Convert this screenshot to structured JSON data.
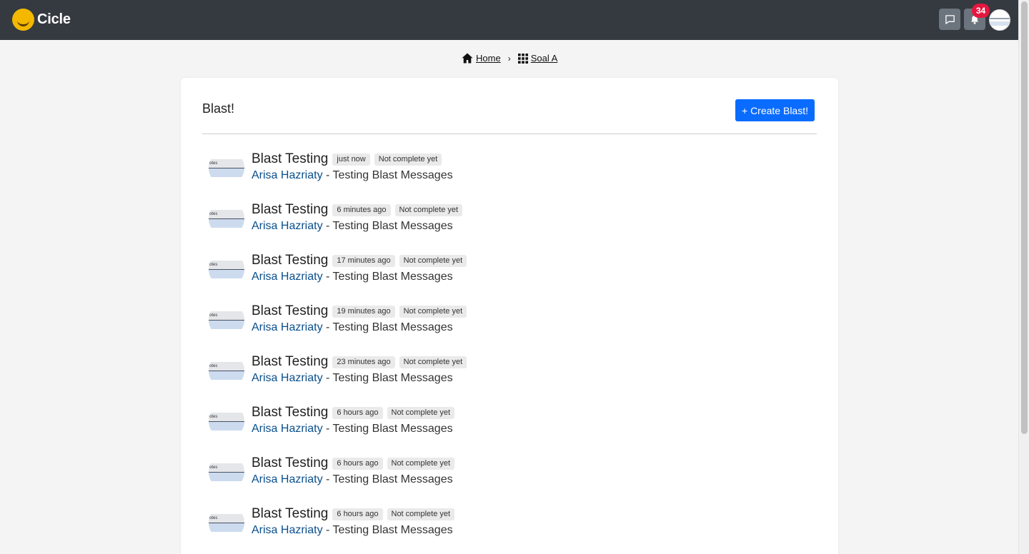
{
  "app": {
    "name": "Cicle",
    "notification_count": "34"
  },
  "breadcrumb": {
    "home_label": "Home",
    "current_label": "Soal A"
  },
  "page": {
    "title": "Blast!",
    "create_button_label": "+ Create Blast!"
  },
  "colors": {
    "topbar": "#343a40",
    "accent": "#0a6cff",
    "badge": "#e5173f",
    "author_link": "#0a4f8c"
  },
  "icons": {
    "chat": "chat-icon",
    "bell": "bell-icon",
    "home": "home-icon",
    "grid": "grid-icon"
  },
  "posts": [
    {
      "title": "Blast Testing",
      "time": "just now",
      "status": "Not complete yet",
      "author": "Arisa Hazriaty",
      "subtitle": " - Testing Blast Messages"
    },
    {
      "title": "Blast Testing",
      "time": "6 minutes ago",
      "status": "Not complete yet",
      "author": "Arisa Hazriaty",
      "subtitle": " - Testing Blast Messages"
    },
    {
      "title": "Blast Testing",
      "time": "17 minutes ago",
      "status": "Not complete yet",
      "author": "Arisa Hazriaty",
      "subtitle": " - Testing Blast Messages"
    },
    {
      "title": "Blast Testing",
      "time": "19 minutes ago",
      "status": "Not complete yet",
      "author": "Arisa Hazriaty",
      "subtitle": " - Testing Blast Messages"
    },
    {
      "title": "Blast Testing",
      "time": "23 minutes ago",
      "status": "Not complete yet",
      "author": "Arisa Hazriaty",
      "subtitle": " - Testing Blast Messages"
    },
    {
      "title": "Blast Testing",
      "time": "6 hours ago",
      "status": "Not complete yet",
      "author": "Arisa Hazriaty",
      "subtitle": " - Testing Blast Messages"
    },
    {
      "title": "Blast Testing",
      "time": "6 hours ago",
      "status": "Not complete yet",
      "author": "Arisa Hazriaty",
      "subtitle": " - Testing Blast Messages"
    },
    {
      "title": "Blast Testing",
      "time": "6 hours ago",
      "status": "Not complete yet",
      "author": "Arisa Hazriaty",
      "subtitle": " - Testing Blast Messages"
    }
  ]
}
